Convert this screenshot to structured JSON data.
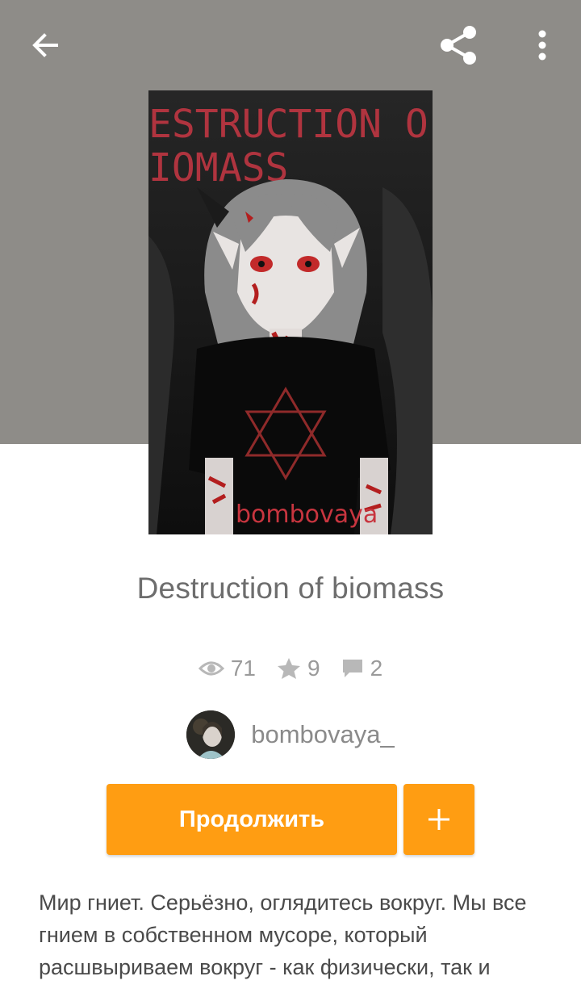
{
  "toolbar": {
    "back_icon": "arrow-left-icon",
    "share_icon": "share-icon",
    "more_icon": "more-vertical-icon"
  },
  "cover": {
    "title_art_line1": "ESTRUCTION OF",
    "title_art_line2": "IOMASS",
    "signature": "bombovaya"
  },
  "story": {
    "title": "Destruction of biomass"
  },
  "stats": {
    "views": "71",
    "votes": "9",
    "comments": "2",
    "views_icon": "eye-icon",
    "votes_icon": "star-icon",
    "comments_icon": "comment-icon"
  },
  "author": {
    "name": "bombovaya_"
  },
  "actions": {
    "continue_label": "Продолжить",
    "add_icon": "plus-icon"
  },
  "description": "Мир гниет. Серьёзно, оглядитесь вокруг. Мы все гнием в собственном мусоре, который расшвыриваем вокруг - как физически, так и",
  "colors": {
    "header_bg": "#8e8c88",
    "accent": "#ff9d12"
  }
}
